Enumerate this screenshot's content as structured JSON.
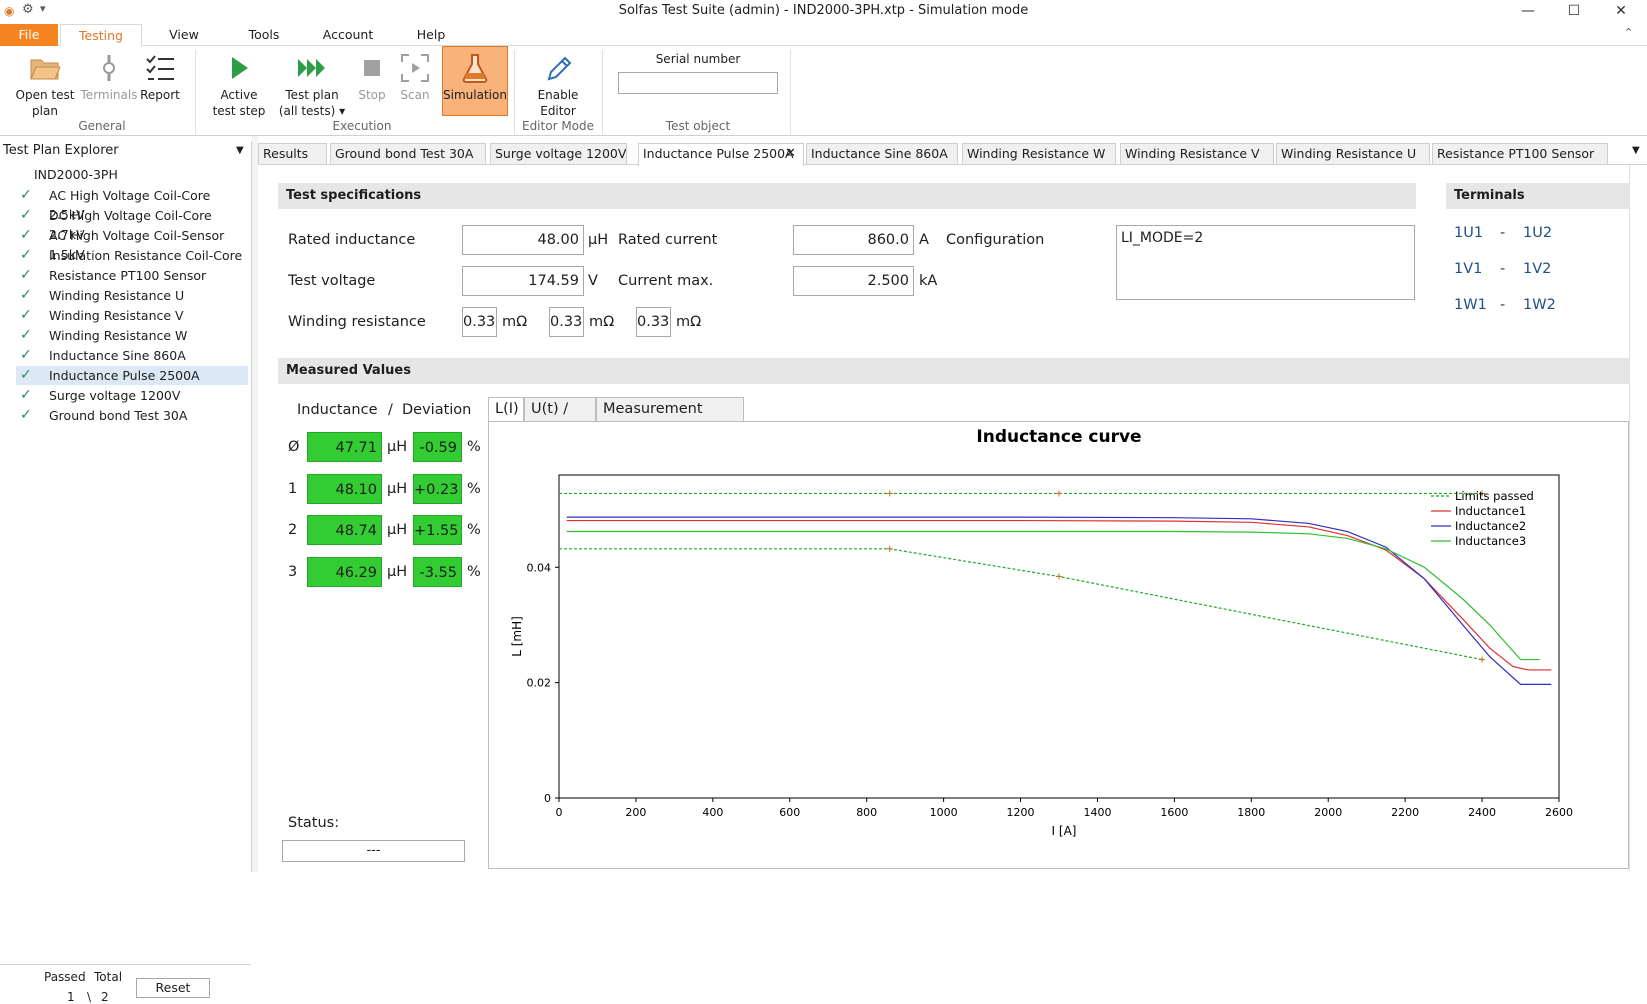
{
  "window": {
    "title": "Solfas Test Suite (admin)  - IND2000-3PH.xtp - Simulation mode",
    "minimize": "—",
    "maximize": "☐",
    "close": "✕"
  },
  "menu": {
    "items": [
      "File",
      "Testing",
      "View",
      "Tools",
      "Account",
      "Help"
    ],
    "active": "Testing"
  },
  "ribbon": {
    "general": {
      "label": "General",
      "open_test_plan": "Open test\nplan",
      "terminals": "Terminals",
      "report": "Report"
    },
    "execution": {
      "label": "Execution",
      "active_test_step": "Active\ntest step",
      "test_plan_all": "Test plan\n(all tests) ▾",
      "stop": "Stop",
      "scan": "Scan",
      "simulation": "Simulation"
    },
    "editor_mode": {
      "label": "Editor Mode",
      "enable_editor": "Enable\nEditor"
    },
    "test_object": {
      "label": "Test object",
      "serial_number_label": "Serial number",
      "serial_number_value": ""
    }
  },
  "explorer": {
    "title": "Test Plan Explorer",
    "root": "IND2000-3PH",
    "items": [
      {
        "label": "AC High Voltage Coil-Core 2.5kV",
        "passed": true
      },
      {
        "label": "DC High Voltage Coil-Core 2.7kV",
        "passed": true
      },
      {
        "label": "AC High Voltage Coil-Sensor 1.5kV",
        "passed": true
      },
      {
        "label": "Insulation Resistance Coil-Core",
        "passed": true
      },
      {
        "label": "Resistance PT100 Sensor",
        "passed": true
      },
      {
        "label": "Winding Resistance U",
        "passed": true
      },
      {
        "label": "Winding Resistance  V",
        "passed": true
      },
      {
        "label": "Winding Resistance  W",
        "passed": true
      },
      {
        "label": "Inductance Sine 860A",
        "passed": true
      },
      {
        "label": "Inductance Pulse 2500A",
        "passed": true,
        "selected": true
      },
      {
        "label": "Surge voltage 1200V",
        "passed": true
      },
      {
        "label": "Ground bond Test 30A",
        "passed": true
      }
    ],
    "footer": {
      "passed_label": "Passed",
      "total_label": "Total",
      "passed_value": "1",
      "separator": "\\",
      "total_value": "2",
      "reset": "Reset"
    }
  },
  "doc_tabs": [
    "Results",
    "Ground bond Test 30A",
    "Surge voltage 1200V",
    "Inductance Pulse 2500A",
    "Inductance Sine 860A",
    "Winding Resistance  W",
    "Winding Resistance  V",
    "Winding Resistance U",
    "Resistance PT100 Sensor"
  ],
  "spec": {
    "header": "Test specifications",
    "rated_inductance_label": "Rated inductance",
    "rated_inductance_value": "48.00",
    "rated_inductance_unit": "µH",
    "rated_current_label": "Rated current",
    "rated_current_value": "860.0",
    "rated_current_unit": "A",
    "configuration_label": "Configuration",
    "configuration_value": "LI_MODE=2",
    "test_voltage_label": "Test voltage",
    "test_voltage_value": "174.59",
    "test_voltage_unit": "V",
    "current_max_label": "Current max.",
    "current_max_value": "2.500",
    "current_max_unit": "kA",
    "winding_resistance_label": "Winding resistance",
    "winding_resistance_values": [
      "0.33",
      "0.33",
      "0.33"
    ],
    "winding_resistance_unit": "mΩ"
  },
  "terminals": {
    "header": "Terminals",
    "pairs": [
      {
        "a": "1U1",
        "sep": "-",
        "b": "1U2"
      },
      {
        "a": "1V1",
        "sep": "-",
        "b": "1V2"
      },
      {
        "a": "1W1",
        "sep": "-",
        "b": "1W2"
      }
    ]
  },
  "measured": {
    "header": "Measured Values",
    "col_inductance": "Inductance",
    "col_sep": "/",
    "col_deviation": "Deviation",
    "rows": [
      {
        "label": "Ø",
        "value": "47.71",
        "unit": "µH",
        "deviation": "-0.59",
        "dev_unit": "%"
      },
      {
        "label": "1",
        "value": "48.10",
        "unit": "µH",
        "deviation": "+0.23",
        "dev_unit": "%"
      },
      {
        "label": "2",
        "value": "48.74",
        "unit": "µH",
        "deviation": "+1.55",
        "dev_unit": "%"
      },
      {
        "label": "3",
        "value": "46.29",
        "unit": "µH",
        "deviation": "-3.55",
        "dev_unit": "%"
      }
    ],
    "status_label": "Status:",
    "status_value": "---"
  },
  "chart_tabs": [
    "L(I)",
    "U(t) / I(t)",
    "Measurement table"
  ],
  "colors": {
    "accent": "#f58320",
    "pass_green": "#33cc33",
    "limits": "#22aa22",
    "inductance1": "#e03030",
    "inductance2": "#3030c0",
    "inductance3": "#30c030"
  },
  "chart_data": {
    "type": "line",
    "title": "Inductance curve",
    "xlabel": "I [A]",
    "ylabel": "L [mH]",
    "xlim": [
      0,
      2600
    ],
    "ylim": [
      0,
      0.056
    ],
    "xticks": [
      0,
      200,
      400,
      600,
      800,
      1000,
      1200,
      1400,
      1600,
      1800,
      2000,
      2200,
      2400,
      2600
    ],
    "yticks": [
      0,
      0.02,
      0.04
    ],
    "ytick_labels": [
      "0",
      "0.02",
      "0.04"
    ],
    "legend_position": "top-right",
    "series": [
      {
        "name": "Limits passed",
        "style": "dashed",
        "color": "#22aa22",
        "x": [
          0,
          860,
          1300,
          2400
        ],
        "y": [
          0.0528,
          0.0528,
          0.0528,
          0.0528
        ],
        "markers": [
          860,
          1300,
          2400
        ]
      },
      {
        "name": "",
        "style": "dashed",
        "color": "#22aa22",
        "x": [
          0,
          860,
          1300,
          2400
        ],
        "y": [
          0.0432,
          0.0432,
          0.0384,
          0.024
        ],
        "markers": [
          860,
          1300,
          2400
        ]
      },
      {
        "name": "Inductance1",
        "style": "solid",
        "color": "#e03030",
        "x": [
          20,
          400,
          800,
          1200,
          1600,
          1800,
          1950,
          2050,
          2150,
          2250,
          2350,
          2420,
          2480,
          2520,
          2580
        ],
        "y": [
          0.0481,
          0.0481,
          0.0481,
          0.0481,
          0.048,
          0.0478,
          0.047,
          0.0455,
          0.043,
          0.038,
          0.031,
          0.026,
          0.0228,
          0.0222,
          0.0222
        ]
      },
      {
        "name": "Inductance2",
        "style": "solid",
        "color": "#3030c0",
        "x": [
          20,
          400,
          800,
          1200,
          1600,
          1800,
          1950,
          2050,
          2150,
          2250,
          2350,
          2420,
          2500,
          2580
        ],
        "y": [
          0.0487,
          0.0487,
          0.0487,
          0.0487,
          0.0486,
          0.0484,
          0.0476,
          0.0462,
          0.0435,
          0.038,
          0.03,
          0.0245,
          0.0197,
          0.0197
        ]
      },
      {
        "name": "Inductance3",
        "style": "solid",
        "color": "#30c030",
        "x": [
          20,
          400,
          800,
          1200,
          1600,
          1800,
          1950,
          2050,
          2150,
          2250,
          2350,
          2420,
          2500,
          2550
        ],
        "y": [
          0.0462,
          0.0462,
          0.0462,
          0.0462,
          0.0462,
          0.0461,
          0.0458,
          0.045,
          0.0432,
          0.04,
          0.0345,
          0.03,
          0.024,
          0.024
        ]
      }
    ]
  }
}
